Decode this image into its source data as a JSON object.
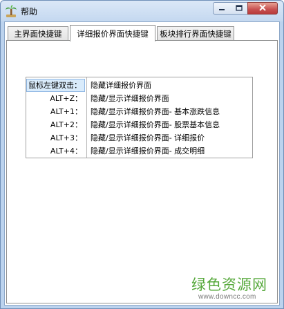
{
  "window": {
    "title": "帮助",
    "icon": "palm-tree-icon",
    "controls": {
      "minimize": "minimize-icon",
      "maximize": "maximize-icon",
      "close": "close-icon"
    }
  },
  "tabs": [
    {
      "label": "主界面快捷键",
      "active": false
    },
    {
      "label": "详细报价界面快捷键",
      "active": true
    },
    {
      "label": "板块排行界面快捷键",
      "active": false
    }
  ],
  "shortcuts": [
    {
      "key": "鼠标左键双击：",
      "desc": "隐藏详细报价界面",
      "selected": true
    },
    {
      "key": "ALT+Z：",
      "desc": "隐藏/显示详细报价界面",
      "selected": false
    },
    {
      "key": "ALT+1：",
      "desc": "隐藏/显示详细报价界面- 基本涨跌信息",
      "selected": false
    },
    {
      "key": "ALT+2：",
      "desc": "隐藏/显示详细报价界面- 股票基本信息",
      "selected": false
    },
    {
      "key": "ALT+3：",
      "desc": "隐藏/显示详细报价界面- 详细报价",
      "selected": false
    },
    {
      "key": "ALT+4：",
      "desc": "隐藏/显示详细报价界面- 成交明细",
      "selected": false
    }
  ],
  "watermark": {
    "logo_text": "绿色资源网",
    "url": "www.downcc.com",
    "color": "#55a83a"
  }
}
